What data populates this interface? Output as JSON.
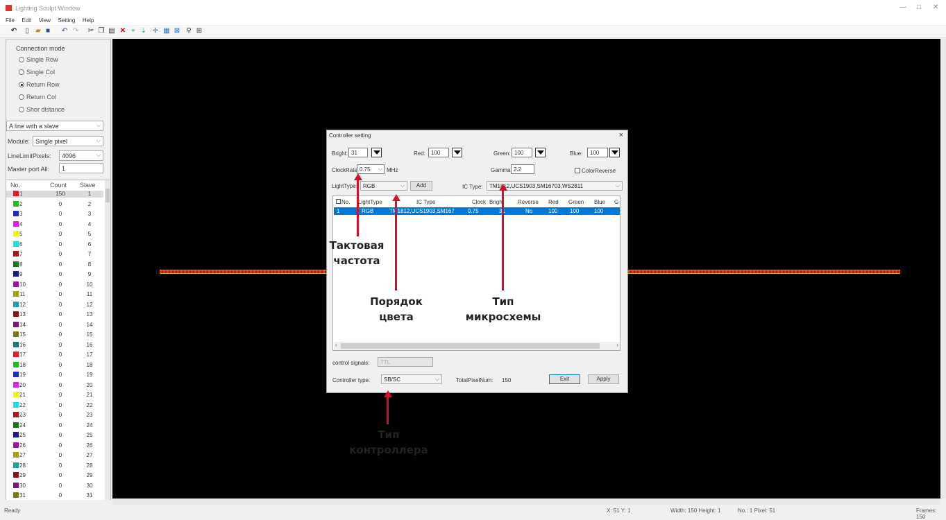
{
  "window": {
    "title": "Lighting Sculpt Window"
  },
  "menu": [
    "File",
    "Edit",
    "View",
    "Setting",
    "Help"
  ],
  "left_panel": {
    "connection_mode_label": "Connection mode",
    "modes": [
      {
        "label": "Single Row",
        "selected": false
      },
      {
        "label": "Single Col",
        "selected": false
      },
      {
        "label": "Return Row",
        "selected": true
      },
      {
        "label": "Return Col",
        "selected": false
      },
      {
        "label": "Shor distance",
        "selected": false
      }
    ],
    "slave_mode": "A line with a slave",
    "module_label": "Module:",
    "module_value": "Single pixel",
    "line_limit_label": "LineLimitPixels:",
    "line_limit_value": "4096",
    "master_port_label": "Master port All:",
    "master_port_value": "1",
    "list_headers": {
      "no": "No.",
      "count": "Count",
      "slave": "Slave"
    },
    "rows": [
      {
        "no": "1",
        "count": "150",
        "slave": "1",
        "color": "#e8192c"
      },
      {
        "no": "2",
        "count": "0",
        "slave": "2",
        "color": "#19c21e"
      },
      {
        "no": "3",
        "count": "0",
        "slave": "3",
        "color": "#1f2ec9"
      },
      {
        "no": "4",
        "count": "0",
        "slave": "4",
        "color": "#e31ce6"
      },
      {
        "no": "5",
        "count": "0",
        "slave": "5",
        "color": "#f2f215"
      },
      {
        "no": "6",
        "count": "0",
        "slave": "6",
        "color": "#18e0e6"
      },
      {
        "no": "7",
        "count": "0",
        "slave": "7",
        "color": "#a8141a"
      },
      {
        "no": "8",
        "count": "0",
        "slave": "8",
        "color": "#16761c"
      },
      {
        "no": "9",
        "count": "0",
        "slave": "9",
        "color": "#18188f"
      },
      {
        "no": "10",
        "count": "0",
        "slave": "10",
        "color": "#a30fa8"
      },
      {
        "no": "11",
        "count": "0",
        "slave": "11",
        "color": "#a3a312"
      },
      {
        "no": "12",
        "count": "0",
        "slave": "12",
        "color": "#17a3a8"
      },
      {
        "no": "13",
        "count": "0",
        "slave": "13",
        "color": "#8c1515"
      },
      {
        "no": "14",
        "count": "0",
        "slave": "14",
        "color": "#7c1a7c"
      },
      {
        "no": "15",
        "count": "0",
        "slave": "15",
        "color": "#777a14"
      },
      {
        "no": "16",
        "count": "0",
        "slave": "16",
        "color": "#147a7a"
      },
      {
        "no": "17",
        "count": "0",
        "slave": "17",
        "color": "#e8192c"
      },
      {
        "no": "18",
        "count": "0",
        "slave": "18",
        "color": "#19c21e"
      },
      {
        "no": "19",
        "count": "0",
        "slave": "19",
        "color": "#1f2ec9"
      },
      {
        "no": "20",
        "count": "0",
        "slave": "20",
        "color": "#e31ce6"
      },
      {
        "no": "21",
        "count": "0",
        "slave": "21",
        "color": "#f2f215"
      },
      {
        "no": "22",
        "count": "0",
        "slave": "22",
        "color": "#18e0e6"
      },
      {
        "no": "23",
        "count": "0",
        "slave": "23",
        "color": "#a8141a"
      },
      {
        "no": "24",
        "count": "0",
        "slave": "24",
        "color": "#16761c"
      },
      {
        "no": "25",
        "count": "0",
        "slave": "25",
        "color": "#18188f"
      },
      {
        "no": "26",
        "count": "0",
        "slave": "26",
        "color": "#a30fa8"
      },
      {
        "no": "27",
        "count": "0",
        "slave": "27",
        "color": "#a3a312"
      },
      {
        "no": "28",
        "count": "0",
        "slave": "28",
        "color": "#17a3a8"
      },
      {
        "no": "29",
        "count": "0",
        "slave": "29",
        "color": "#8c1515"
      },
      {
        "no": "30",
        "count": "0",
        "slave": "30",
        "color": "#7c1a7c"
      },
      {
        "no": "31",
        "count": "0",
        "slave": "31",
        "color": "#777a14"
      }
    ]
  },
  "dialog": {
    "title": "Controller setting",
    "close": "×",
    "bright_label": "Bright:",
    "bright_value": "31",
    "red_label": "Red:",
    "red_value": "100",
    "green_label": "Green:",
    "green_value": "100",
    "blue_label": "Blue:",
    "blue_value": "100",
    "clock_label": "ClockRate:",
    "clock_value": "0.75",
    "clock_unit": "MHz",
    "gamma_label": "Gamma:",
    "gamma_value": "2.2",
    "color_reverse_label": "ColorReverse",
    "light_type_label": "LightType:",
    "light_type_value": "RGB",
    "add_label": "Add",
    "ic_type_label": "IC Type:",
    "ic_type_value": "TM1812,UCS1903,SM16703,WS2811",
    "grid_headers": [
      "No.",
      "LightType",
      "IC Type",
      "Clock",
      "Bright",
      "Reverse",
      "Red",
      "Green",
      "Blue",
      "G"
    ],
    "grid_row": [
      "1",
      "RGB",
      "TM1812,UCS1903,SM167",
      "0.75",
      "31",
      "No",
      "100",
      "100",
      "100"
    ],
    "control_signals_label": "control signals:",
    "control_signals_value": "TTL",
    "controller_type_label": "Controller type:",
    "controller_type_value": "SB/SC",
    "total_pixel_label": "TotalPixelNum:",
    "total_pixel_value": "150",
    "exit_label": "Exit",
    "apply_label": "Apply"
  },
  "status": {
    "ready": "Ready",
    "xy": "X: 51 Y: 1",
    "size": "Width: 150 Height: 1",
    "pixel": "No.: 1 Pixel: 51",
    "frames": "Frames: 150"
  },
  "annotations": {
    "clock": "Тактовая частота",
    "color_order": "Порядок цвета",
    "ic_type": "Тип микросхемы",
    "controller_type": "Тип контроллера"
  },
  "accent_color": "#d2102b"
}
